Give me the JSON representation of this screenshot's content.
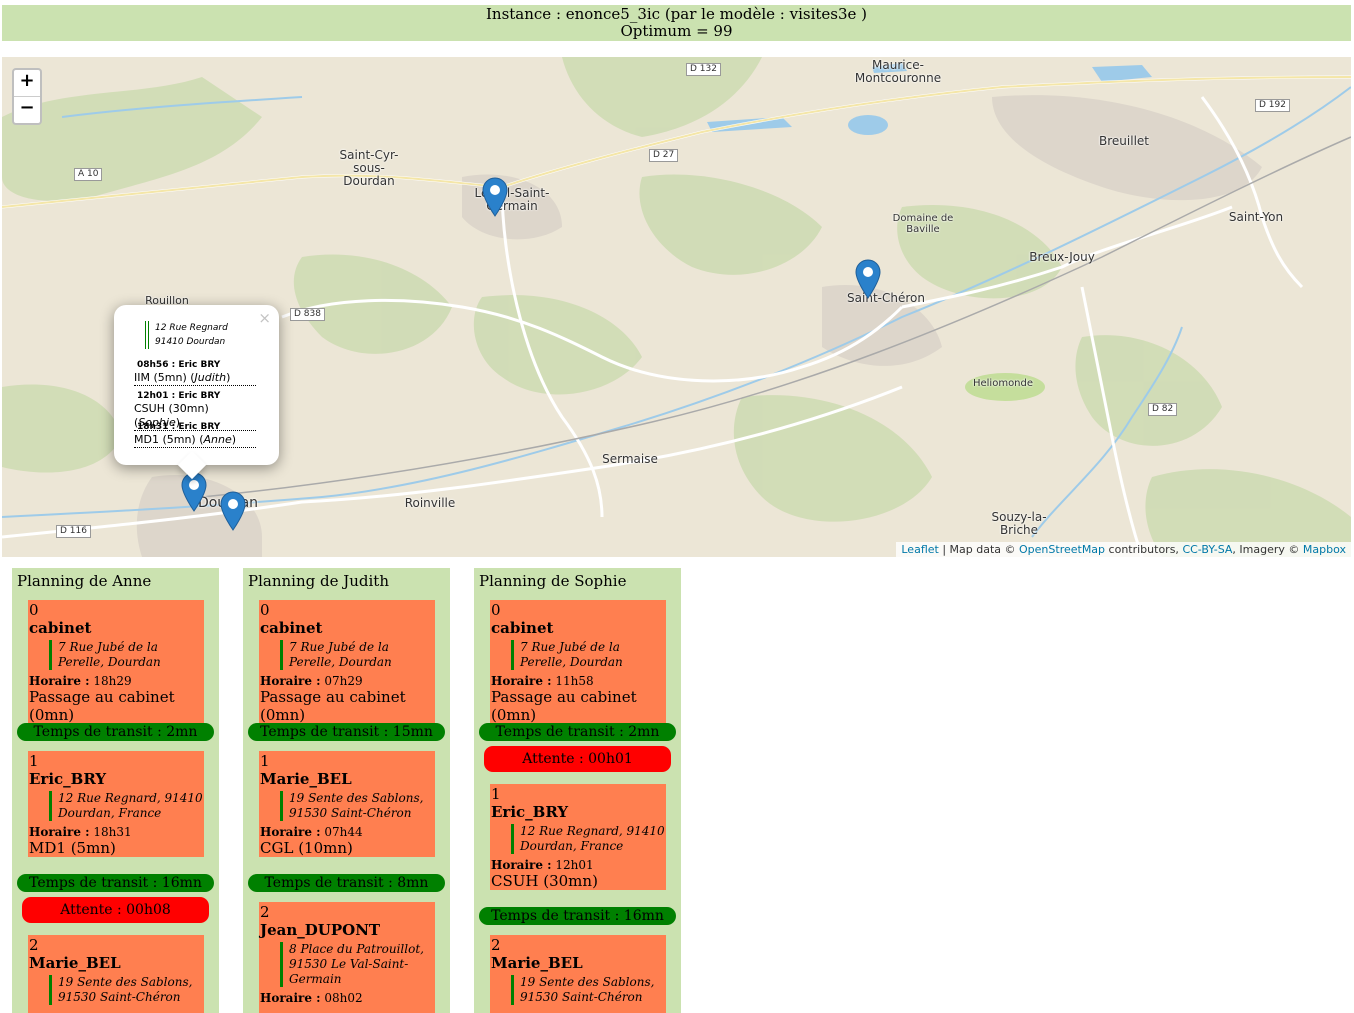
{
  "header": {
    "line1": "Instance : enonce5_3ic (par le modèle : visites3e )",
    "line2": "Optimum = 99"
  },
  "map": {
    "zoom_in": "+",
    "zoom_out": "−",
    "places": {
      "maurice": "Maurice-\nMontcouronne",
      "breuillet": "Breuillet",
      "saint_yon": "Saint-Yon",
      "saint_cyr": "Saint-Cyr-\nsous-\nDourdan",
      "val_st_germain": "Le Val-Saint-\nGermain",
      "domaine": "Domaine de\nBaville",
      "breux": "Breux-Jouy",
      "saint_cheron": "Saint-Chéron",
      "rouillon": "Rouillon",
      "heliomonde": "Heliomonde",
      "sermaise": "Sermaise",
      "roinville": "Roinville",
      "dourdan": "Dourdan",
      "souzy": "Souzy-la-\nBriche"
    },
    "roads": {
      "d132": "D 132",
      "d192": "D 192",
      "d27": "D 27",
      "a10": "A 10",
      "d838": "D 838",
      "d82": "D 82",
      "d116": "D 116"
    },
    "attribution": {
      "leaflet": "Leaflet",
      "sep1": " | Map data © ",
      "osm": "OpenStreetMap",
      "sep2": " contributors, ",
      "cc": "CC-BY-SA",
      "sep3": ", Imagery © ",
      "mapbox": "Mapbox"
    },
    "popup": {
      "close": "×",
      "addr_line1": "12 Rue Regnard",
      "addr_line2": "91410 Dourdan",
      "visits": [
        {
          "time": "08h56 :  Eric BRY",
          "detail": "IIM (5mn) (",
          "who": "Judith",
          "end": ")"
        },
        {
          "time": "12h01 :  Eric BRY",
          "detail": "CSUH (30mn) (",
          "who": "Sophie",
          "end": ")"
        },
        {
          "time": "18h31 :  Eric BRY",
          "detail": "MD1 (5mn) (",
          "who": "Anne",
          "end": ")"
        }
      ]
    }
  },
  "plannings": [
    {
      "title": "Planning de Anne",
      "cards": [
        {
          "num": "0",
          "name": "cabinet",
          "addr": "7 Rue Jubé de la Perelle, Dourdan",
          "hor_label": "Horaire :",
          "hor": " 18h29",
          "act": "Passage au cabinet (0mn)"
        },
        {
          "num": "1",
          "name": "Eric_BRY",
          "addr": "12 Rue Regnard, 91410 Dourdan, France",
          "hor_label": "Horaire :",
          "hor": " 18h31",
          "act": "MD1 (5mn)"
        },
        {
          "num": "2",
          "name": "Marie_BEL",
          "addr": "19 Sente des Sablons, 91530 Saint-Chéron",
          "hor_label": "",
          "hor": "",
          "act": ""
        }
      ],
      "transits": [
        "Temps de transit : 2mn",
        "Temps de transit : 16mn"
      ],
      "waits": [
        "Attente : 00h08"
      ]
    },
    {
      "title": "Planning de Judith",
      "cards": [
        {
          "num": "0",
          "name": "cabinet",
          "addr": "7 Rue Jubé de la Perelle, Dourdan",
          "hor_label": "Horaire :",
          "hor": " 07h29",
          "act": "Passage au cabinet (0mn)"
        },
        {
          "num": "1",
          "name": "Marie_BEL",
          "addr": "19 Sente des Sablons, 91530 Saint-Chéron",
          "hor_label": "Horaire :",
          "hor": " 07h44",
          "act": "CGL (10mn)"
        },
        {
          "num": "2",
          "name": "Jean_DUPONT",
          "addr": "8 Place du Patrouillot, 91530 Le Val-Saint-Germain",
          "hor_label": "Horaire :",
          "hor": " 08h02",
          "act": ""
        }
      ],
      "transits": [
        "Temps de transit : 15mn",
        "Temps de transit : 8mn"
      ],
      "waits": []
    },
    {
      "title": "Planning de Sophie",
      "cards": [
        {
          "num": "0",
          "name": "cabinet",
          "addr": "7 Rue Jubé de la Perelle, Dourdan",
          "hor_label": "Horaire :",
          "hor": " 11h58",
          "act": "Passage au cabinet (0mn)"
        },
        {
          "num": "1",
          "name": "Eric_BRY",
          "addr": "12 Rue Regnard, 91410 Dourdan, France",
          "hor_label": "Horaire :",
          "hor": " 12h01",
          "act": "CSUH (30mn)"
        },
        {
          "num": "2",
          "name": "Marie_BEL",
          "addr": "19 Sente des Sablons, 91530 Saint-Chéron",
          "hor_label": "",
          "hor": "",
          "act": ""
        }
      ],
      "transits": [
        "Temps de transit : 2mn",
        "Temps de transit : 16mn"
      ],
      "waits": [
        "Attente : 00h01"
      ]
    }
  ]
}
